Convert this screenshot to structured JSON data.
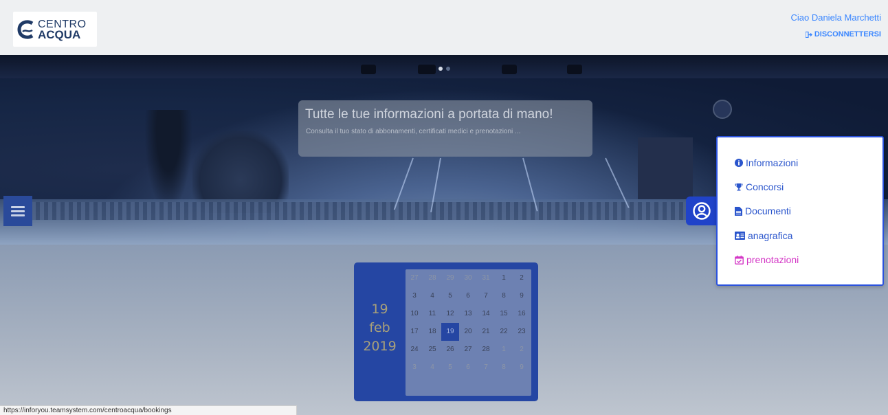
{
  "header": {
    "logo_line1": "CENTRO",
    "logo_line2": "ACQUA",
    "greeting": "Ciao Daniela Marchetti",
    "logout_label": "DISCONNETTERSI"
  },
  "hero": {
    "title": "Tutte le tue informazioni a portata di mano!",
    "subtitle": "Consulta il tuo stato di abbonamenti, certificati medici e prenotazioni ...",
    "slide_dots": 2,
    "active_slide": 1
  },
  "calendar": {
    "day": "19",
    "month": "feb",
    "year": "2019",
    "weeks": [
      [
        {
          "d": "27",
          "out": true
        },
        {
          "d": "28",
          "out": true
        },
        {
          "d": "29",
          "out": true
        },
        {
          "d": "30",
          "out": true
        },
        {
          "d": "31",
          "out": true
        },
        {
          "d": "1"
        },
        {
          "d": "2"
        }
      ],
      [
        {
          "d": "3"
        },
        {
          "d": "4"
        },
        {
          "d": "5"
        },
        {
          "d": "6"
        },
        {
          "d": "7"
        },
        {
          "d": "8"
        },
        {
          "d": "9"
        }
      ],
      [
        {
          "d": "10"
        },
        {
          "d": "11"
        },
        {
          "d": "12"
        },
        {
          "d": "13"
        },
        {
          "d": "14"
        },
        {
          "d": "15"
        },
        {
          "d": "16"
        }
      ],
      [
        {
          "d": "17"
        },
        {
          "d": "18"
        },
        {
          "d": "19",
          "sel": true
        },
        {
          "d": "20"
        },
        {
          "d": "21"
        },
        {
          "d": "22"
        },
        {
          "d": "23"
        }
      ],
      [
        {
          "d": "24"
        },
        {
          "d": "25"
        },
        {
          "d": "26"
        },
        {
          "d": "27"
        },
        {
          "d": "28"
        },
        {
          "d": "1",
          "out": true
        },
        {
          "d": "2",
          "out": true
        }
      ],
      [
        {
          "d": "3",
          "out": true
        },
        {
          "d": "4",
          "out": true
        },
        {
          "d": "5",
          "out": true
        },
        {
          "d": "6",
          "out": true
        },
        {
          "d": "7",
          "out": true
        },
        {
          "d": "8",
          "out": true
        },
        {
          "d": "9",
          "out": true
        }
      ]
    ]
  },
  "user_menu": {
    "items": [
      {
        "label": "Informazioni",
        "icon": "info-circle-icon"
      },
      {
        "label": "Concorsi",
        "icon": "trophy-icon"
      },
      {
        "label": "Documenti",
        "icon": "document-icon"
      },
      {
        "label": "anagrafica",
        "icon": "id-card-icon"
      },
      {
        "label": "prenotazioni",
        "icon": "calendar-check-icon",
        "active": true
      }
    ],
    "active_color": "#d438c6",
    "link_color": "#2a55cc"
  },
  "status_bar": {
    "url": "https://inforyou.teamsystem.com/centroacqua/bookings"
  },
  "colors": {
    "brand_blue": "#2546a3",
    "accent_blue": "#3a86ff"
  }
}
